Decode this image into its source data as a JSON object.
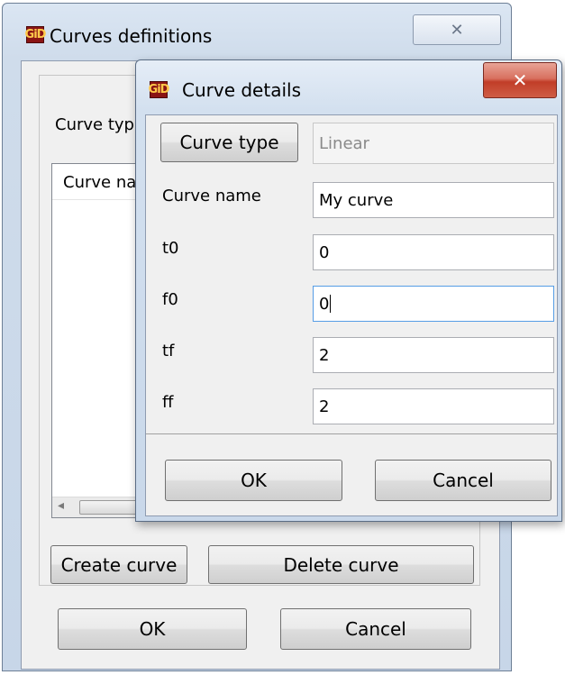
{
  "outer_window": {
    "title": "Curves definitions",
    "app_icon_text": "GiD",
    "close_glyph": "✕",
    "curve_type_label": "Curve typ",
    "list_header": "Curve na",
    "scroll_left_glyph": "◂",
    "create_button": "Create curve",
    "delete_button": "Delete curve",
    "ok_button": "OK",
    "cancel_button": "Cancel"
  },
  "inner_dialog": {
    "title": "Curve details",
    "app_icon_text": "GiD",
    "close_glyph": "✕",
    "curve_type_button": "Curve type",
    "curve_type_value": "Linear",
    "fields": [
      {
        "label": "Curve name",
        "value": "My curve"
      },
      {
        "label": "t0",
        "value": "0"
      },
      {
        "label": "f0",
        "value": "0"
      },
      {
        "label": "tf",
        "value": "2"
      },
      {
        "label": "ff",
        "value": "2"
      }
    ],
    "ok_button": "OK",
    "cancel_button": "Cancel"
  },
  "colors": {
    "close_active": "#c13d28",
    "icon_bg": "#8a1414",
    "icon_fg": "#ffc94a",
    "focus_border": "#569de5"
  }
}
